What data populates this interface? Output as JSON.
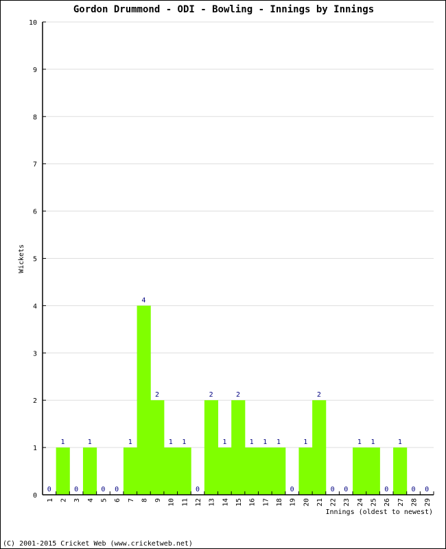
{
  "footer": "(C) 2001-2015 Cricket Web (www.cricketweb.net)",
  "colors": {
    "bar": "#80ff00",
    "label": "#000080",
    "grid": "#dddddd"
  },
  "chart_data": {
    "type": "bar",
    "title": "Gordon Drummond - ODI - Bowling - Innings by Innings",
    "xlabel": "Innings (oldest to newest)",
    "ylabel": "Wickets",
    "ylim": [
      0,
      10
    ],
    "yticks": [
      "0",
      "1",
      "2",
      "3",
      "4",
      "5",
      "6",
      "7",
      "8",
      "9",
      "10"
    ],
    "grid": true,
    "categories": [
      "1",
      "2",
      "3",
      "4",
      "5",
      "6",
      "7",
      "8",
      "9",
      "10",
      "11",
      "12",
      "13",
      "14",
      "15",
      "16",
      "17",
      "18",
      "19",
      "20",
      "21",
      "22",
      "23",
      "24",
      "25",
      "26",
      "27",
      "28",
      "29"
    ],
    "values": [
      0,
      1,
      0,
      1,
      0,
      0,
      1,
      4,
      2,
      1,
      1,
      0,
      2,
      1,
      2,
      1,
      1,
      1,
      0,
      1,
      2,
      0,
      0,
      1,
      1,
      0,
      1,
      0,
      0
    ]
  }
}
